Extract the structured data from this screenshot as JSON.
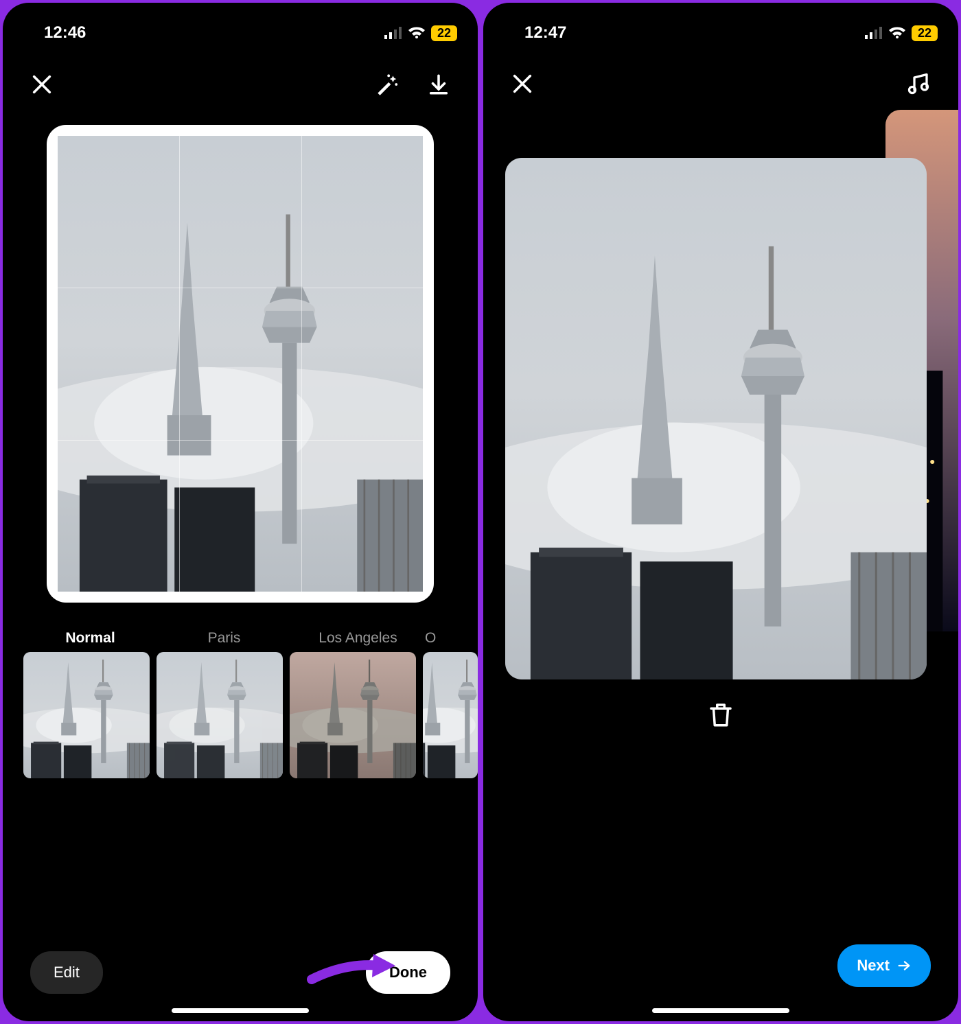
{
  "left": {
    "status": {
      "time": "12:46",
      "battery": "22"
    },
    "filters": [
      "Normal",
      "Paris",
      "Los Angeles",
      "O"
    ],
    "active_filter_index": 0,
    "buttons": {
      "edit": "Edit",
      "done": "Done"
    },
    "icons": {
      "close": "close",
      "magic": "magic-wand",
      "download": "download"
    }
  },
  "right": {
    "status": {
      "time": "12:47",
      "battery": "22"
    },
    "buttons": {
      "next": "Next"
    },
    "icons": {
      "close": "close",
      "music": "music",
      "trash": "trash"
    }
  },
  "colors": {
    "accent": "#0095f6",
    "battery": "#ffcc00",
    "annotation": "#8a2be2"
  }
}
